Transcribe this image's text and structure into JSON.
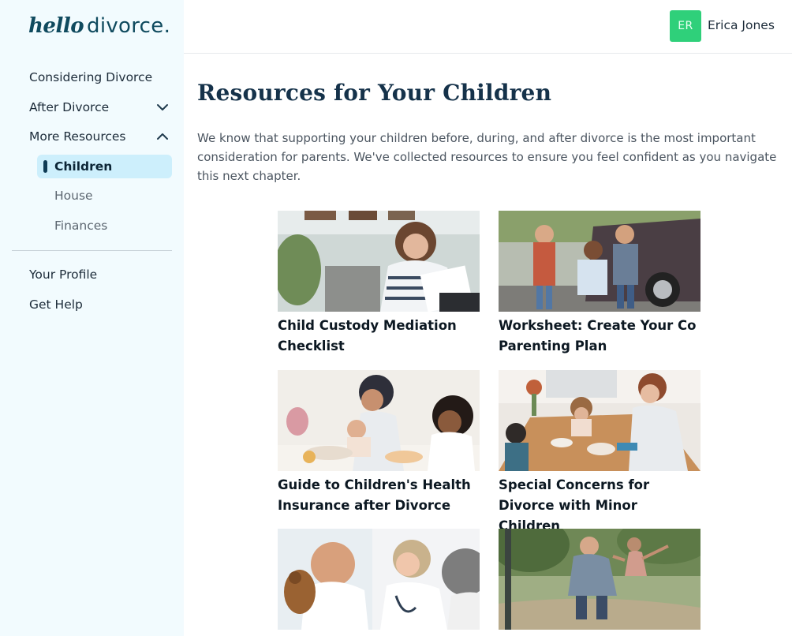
{
  "brand": {
    "logo_script": "hello",
    "logo_text": "divorce."
  },
  "sidebar": {
    "nav": [
      {
        "label": "Considering Divorce"
      },
      {
        "label": "After Divorce",
        "chevron": "chevron-down-icon"
      },
      {
        "label": "More Resources",
        "chevron": "chevron-up-icon"
      }
    ],
    "sub": [
      {
        "label": "Children",
        "active": true
      },
      {
        "label": "House"
      },
      {
        "label": "Finances"
      }
    ],
    "bottom": [
      {
        "label": "Your Profile"
      },
      {
        "label": "Get Help"
      }
    ]
  },
  "user": {
    "initials": "ER",
    "name": "Erica Jones",
    "avatar_color": "#2fd07a"
  },
  "main": {
    "title": "Resources for Your Children",
    "intro": "We know that supporting your children before, during, and after divorce is the most important consideration for parents. We've collected resources to ensure you feel confident as you navigate this next chapter.",
    "cards": [
      {
        "title": "Child Custody Mediation Checklist"
      },
      {
        "title": "Worksheet: Create Your Co Parenting Plan"
      },
      {
        "title": "Guide to Children's Health Insurance after Divorce"
      },
      {
        "title": "Special Concerns for Divorce with Minor Children"
      },
      {
        "title": ""
      },
      {
        "title": ""
      }
    ]
  },
  "colors": {
    "sidebar_bg": "#f2fbfe",
    "active_bg": "#cdeffc",
    "brand": "#0f4a5e",
    "title": "#15324a"
  }
}
